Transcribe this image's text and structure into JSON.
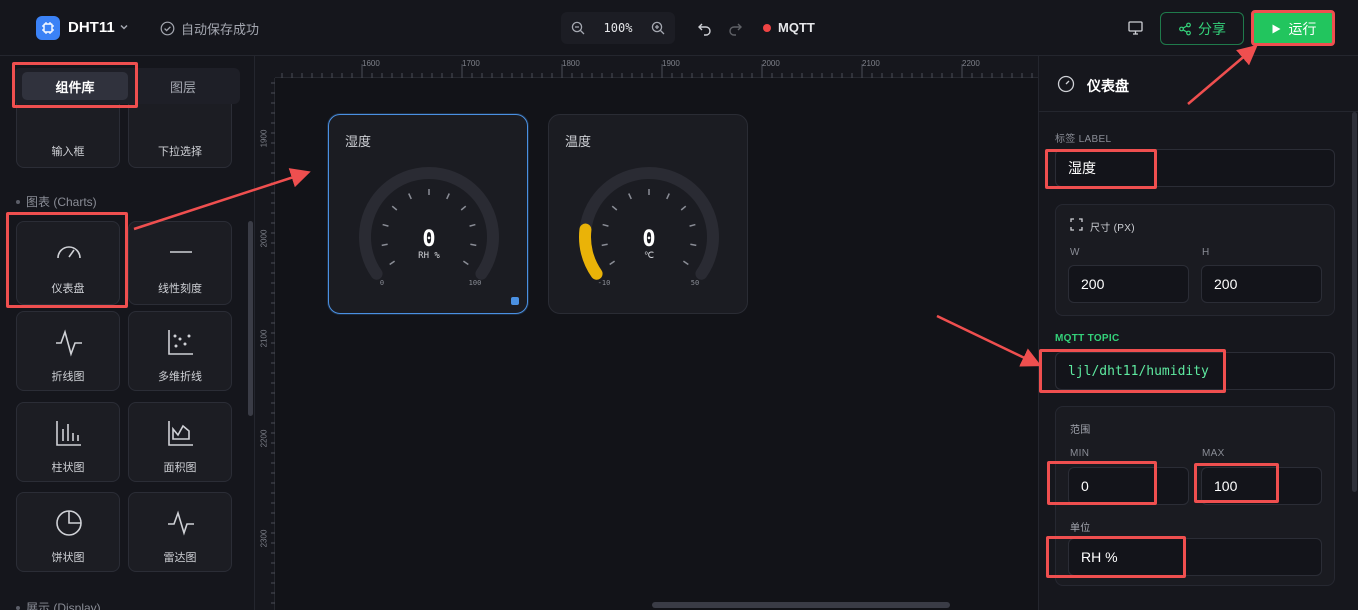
{
  "header": {
    "project_title": "DHT11",
    "autosave_text": "自动保存成功",
    "zoom_level": "100%",
    "connection_label": "MQTT",
    "share_label": "分享",
    "run_label": "运行"
  },
  "sidebar": {
    "tabs": [
      "组件库",
      "图层"
    ],
    "partial_items": [
      "输入框",
      "下拉选择"
    ],
    "charts_section": "图表 (Charts)",
    "chart_items": [
      "仪表盘",
      "线性刻度",
      "折线图",
      "多维折线",
      "柱状图",
      "面积图",
      "饼状图",
      "雷达图"
    ],
    "display_section": "展示 (Display)"
  },
  "canvas": {
    "ruler_x": [
      "1600",
      "1700",
      "1800",
      "1900",
      "2000",
      "2100",
      "2200"
    ],
    "ruler_y": [
      "1900",
      "2000",
      "2100",
      "2200",
      "2300"
    ],
    "gauges": [
      {
        "title": "湿度",
        "value": "0",
        "unit": "RH %",
        "min": "0",
        "max": "100",
        "fill_fraction": 0,
        "selected": true
      },
      {
        "title": "温度",
        "value": "0",
        "unit": "℃",
        "min": "-10",
        "max": "50",
        "fill_fraction": 0.1667,
        "selected": false
      }
    ]
  },
  "properties": {
    "panel_title": "仪表盘",
    "label_caption": "标签 LABEL",
    "label_value": "湿度",
    "size_caption": "尺寸 (PX)",
    "w_caption": "W",
    "w_value": "200",
    "h_caption": "H",
    "h_value": "200",
    "topic_caption": "MQTT TOPIC",
    "topic_value": "ljl/dht11/humidity",
    "range_caption": "范围",
    "min_caption": "MIN",
    "min_value": "0",
    "max_caption": "MAX",
    "max_value": "100",
    "unit_caption": "单位",
    "unit_value": "RH %"
  },
  "colors": {
    "accent_blue": "#4a90e2",
    "run_green": "#22c55e",
    "topic_green": "#34d27a",
    "gauge_fill": "#eab308",
    "status_red": "#ef4444",
    "annotation_red": "#ef4f4f"
  },
  "icons": [
    "chip-icon",
    "chevron-down-icon",
    "check-circle-icon",
    "zoom-out-icon",
    "zoom-in-icon",
    "undo-icon",
    "redo-icon",
    "monitor-icon",
    "share-icon",
    "play-icon",
    "gauge-icon",
    "expand-icon"
  ]
}
